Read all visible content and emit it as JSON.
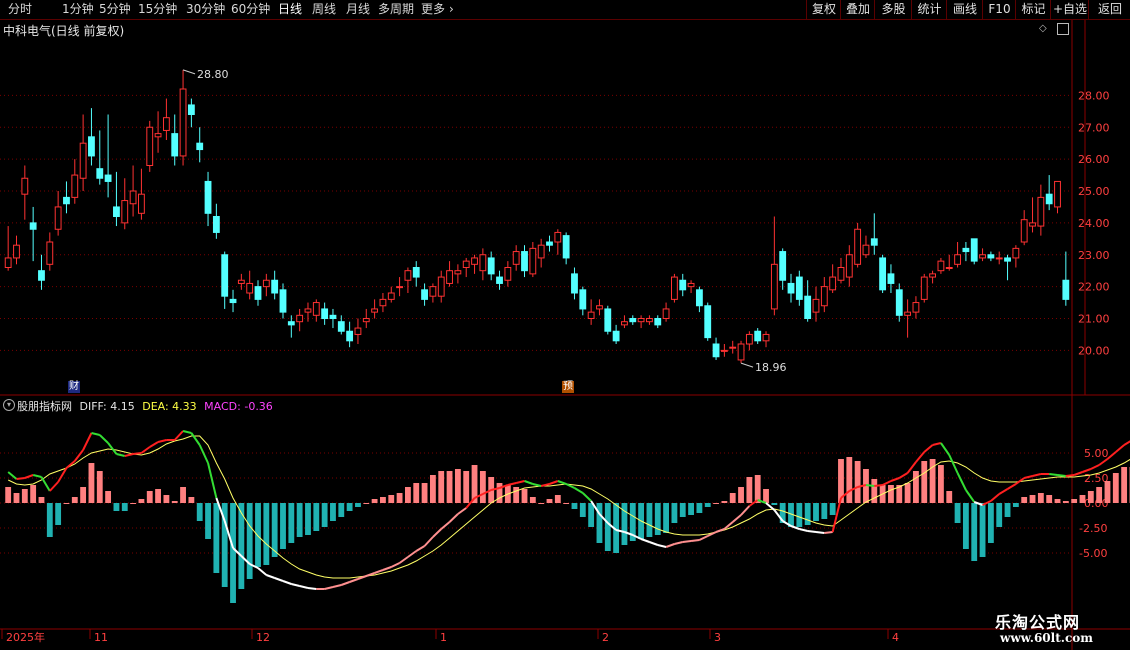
{
  "toolbar": {
    "periods": [
      "分时",
      "1分钟",
      "5分钟",
      "15分钟",
      "30分钟",
      "60分钟",
      "日线",
      "周线",
      "月线",
      "多周期",
      "更多"
    ],
    "active_period": "日线",
    "more_chevron": "›",
    "right_buttons": [
      "复权",
      "叠加",
      "多股",
      "统计",
      "画线",
      "F10",
      "标记",
      "+自选",
      "返回"
    ]
  },
  "stock": {
    "title": "中科电气(日线 前复权)",
    "high_label": "28.80",
    "low_label": "18.96"
  },
  "price_axis": [
    "28.00",
    "27.00",
    "26.00",
    "25.00",
    "24.00",
    "23.00",
    "22.00",
    "21.00",
    "20.00"
  ],
  "event_badges": {
    "cai": "财",
    "yu": "预"
  },
  "indicator": {
    "name": "股朋指标网",
    "diff": "DIFF: 4.15",
    "dea": "DEA: 4.33",
    "macd": "MACD: -0.36"
  },
  "macd_axis": [
    "5.00",
    "2.50",
    "0.00",
    "-2.50",
    "-5.00"
  ],
  "date_axis": [
    "2025年",
    "11",
    "12",
    "1",
    "2",
    "3",
    "4"
  ],
  "watermark": {
    "line1": "乐淘公式网",
    "line2": "www.60lt.com"
  },
  "colors": {
    "up": "#ff3232",
    "up_fill": "#000000",
    "down": "#54ffff",
    "grid": "#7a0000",
    "hist_pos": "#ff8080",
    "hist_neg": "#20b2b2",
    "diff": "#ff2020",
    "dea": "#ffff66",
    "axis_text": "#ff4040"
  },
  "chart_data": {
    "type": "candlestick",
    "price_ylim": [
      18.6,
      29.8
    ],
    "candles": [
      [
        22.6,
        22.9,
        23.9,
        22.5
      ],
      [
        22.9,
        23.3,
        23.6,
        22.7
      ],
      [
        24.9,
        25.4,
        25.8,
        24.1
      ],
      [
        24.0,
        23.8,
        24.5,
        22.8
      ],
      [
        22.5,
        22.2,
        23.0,
        21.9
      ],
      [
        22.7,
        23.4,
        23.7,
        22.5
      ],
      [
        23.8,
        24.5,
        25.0,
        23.6
      ],
      [
        24.8,
        24.6,
        25.3,
        24.3
      ],
      [
        24.8,
        25.5,
        26.0,
        24.6
      ],
      [
        25.4,
        26.5,
        27.4,
        25.0
      ],
      [
        26.7,
        26.1,
        27.6,
        25.8
      ],
      [
        25.7,
        25.4,
        26.9,
        25.2
      ],
      [
        25.5,
        25.3,
        27.4,
        24.8
      ],
      [
        24.5,
        24.2,
        25.6,
        23.9
      ],
      [
        24.0,
        24.7,
        25.4,
        23.8
      ],
      [
        24.6,
        25.0,
        25.8,
        24.2
      ],
      [
        24.3,
        24.9,
        25.7,
        24.1
      ],
      [
        25.8,
        27.0,
        27.2,
        25.6
      ],
      [
        26.7,
        26.8,
        27.5,
        26.2
      ],
      [
        26.9,
        27.3,
        27.9,
        26.6
      ],
      [
        26.8,
        26.1,
        27.4,
        25.8
      ],
      [
        26.1,
        28.2,
        28.8,
        25.8
      ],
      [
        27.7,
        27.4,
        27.9,
        27.0
      ],
      [
        26.5,
        26.3,
        27.0,
        25.9
      ],
      [
        25.3,
        24.3,
        25.6,
        23.9
      ],
      [
        24.2,
        23.7,
        24.6,
        23.5
      ],
      [
        23.0,
        21.7,
        23.1,
        21.3
      ],
      [
        21.6,
        21.5,
        21.9,
        21.2
      ],
      [
        22.1,
        22.2,
        22.4,
        21.9
      ],
      [
        21.8,
        22.1,
        22.5,
        21.6
      ],
      [
        22.0,
        21.6,
        22.2,
        21.4
      ],
      [
        22.0,
        22.2,
        22.4,
        21.7
      ],
      [
        22.2,
        21.8,
        22.5,
        21.6
      ],
      [
        21.9,
        21.2,
        22.1,
        21.0
      ],
      [
        20.9,
        20.8,
        21.1,
        20.4
      ],
      [
        20.9,
        21.1,
        21.3,
        20.6
      ],
      [
        21.2,
        21.3,
        21.5,
        20.9
      ],
      [
        21.1,
        21.5,
        21.6,
        20.9
      ],
      [
        21.3,
        21.0,
        21.5,
        20.8
      ],
      [
        21.1,
        21.0,
        21.3,
        20.7
      ],
      [
        20.9,
        20.6,
        21.1,
        20.5
      ],
      [
        20.6,
        20.3,
        20.9,
        20.1
      ],
      [
        20.5,
        20.7,
        21.0,
        20.2
      ],
      [
        20.9,
        21.0,
        21.3,
        20.7
      ],
      [
        21.2,
        21.3,
        21.6,
        21.0
      ],
      [
        21.4,
        21.6,
        21.8,
        21.2
      ],
      [
        21.6,
        21.8,
        22.0,
        21.5
      ],
      [
        22.0,
        22.0,
        22.3,
        21.7
      ],
      [
        22.2,
        22.5,
        22.6,
        21.8
      ],
      [
        22.6,
        22.3,
        22.8,
        22.0
      ],
      [
        21.9,
        21.6,
        22.1,
        21.4
      ],
      [
        21.7,
        22.0,
        22.1,
        21.5
      ],
      [
        21.7,
        22.3,
        22.5,
        21.5
      ],
      [
        22.1,
        22.5,
        22.8,
        22.0
      ],
      [
        22.4,
        22.5,
        22.7,
        22.1
      ],
      [
        22.6,
        22.8,
        22.9,
        22.3
      ],
      [
        22.7,
        22.9,
        23.0,
        22.4
      ],
      [
        22.5,
        23.0,
        23.2,
        22.2
      ],
      [
        22.9,
        22.4,
        23.1,
        22.2
      ],
      [
        22.3,
        22.1,
        22.5,
        21.9
      ],
      [
        22.2,
        22.6,
        22.8,
        22.0
      ],
      [
        22.7,
        23.1,
        23.3,
        22.5
      ],
      [
        23.1,
        22.5,
        23.3,
        22.3
      ],
      [
        22.4,
        23.2,
        23.4,
        22.3
      ],
      [
        22.9,
        23.3,
        23.5,
        22.6
      ],
      [
        23.4,
        23.3,
        23.6,
        23.1
      ],
      [
        23.4,
        23.7,
        23.8,
        23.0
      ],
      [
        23.6,
        22.9,
        23.7,
        22.7
      ],
      [
        22.4,
        21.8,
        22.6,
        21.6
      ],
      [
        21.9,
        21.3,
        22.0,
        21.1
      ],
      [
        21.0,
        21.2,
        21.6,
        20.8
      ],
      [
        21.3,
        21.4,
        21.6,
        21.1
      ],
      [
        21.3,
        20.6,
        21.4,
        20.5
      ],
      [
        20.6,
        20.3,
        20.8,
        20.2
      ],
      [
        20.8,
        20.9,
        21.1,
        20.7
      ],
      [
        21.0,
        20.9,
        21.1,
        20.8
      ],
      [
        20.9,
        21.0,
        21.1,
        20.7
      ],
      [
        20.9,
        21.0,
        21.1,
        20.8
      ],
      [
        21.0,
        20.8,
        21.1,
        20.7
      ],
      [
        21.0,
        21.3,
        21.5,
        20.9
      ],
      [
        21.6,
        22.3,
        22.4,
        21.5
      ],
      [
        22.2,
        21.9,
        22.4,
        21.7
      ],
      [
        22.0,
        22.1,
        22.2,
        21.8
      ],
      [
        21.9,
        21.4,
        22.0,
        21.2
      ],
      [
        21.4,
        20.4,
        21.5,
        20.3
      ],
      [
        20.2,
        19.8,
        20.4,
        19.7
      ],
      [
        20.0,
        20.0,
        20.2,
        19.8
      ],
      [
        20.1,
        20.1,
        20.3,
        19.9
      ],
      [
        19.7,
        20.2,
        20.3,
        19.6
      ],
      [
        20.2,
        20.5,
        20.6,
        20.0
      ],
      [
        20.6,
        20.3,
        20.7,
        20.2
      ],
      [
        20.3,
        20.5,
        20.6,
        20.1
      ],
      [
        21.3,
        22.7,
        24.2,
        21.1
      ],
      [
        23.1,
        22.2,
        23.2,
        21.9
      ],
      [
        22.1,
        21.8,
        22.4,
        21.5
      ],
      [
        22.3,
        21.6,
        22.5,
        21.4
      ],
      [
        21.7,
        21.0,
        22.2,
        20.9
      ],
      [
        21.2,
        21.6,
        22.0,
        20.9
      ],
      [
        21.4,
        22.0,
        22.3,
        21.2
      ],
      [
        21.9,
        22.3,
        22.7,
        21.8
      ],
      [
        22.2,
        22.6,
        22.9,
        22.1
      ],
      [
        22.3,
        23.0,
        23.3,
        22.0
      ],
      [
        22.7,
        23.8,
        24.0,
        22.6
      ],
      [
        23.0,
        23.3,
        23.6,
        22.9
      ],
      [
        23.5,
        23.3,
        24.3,
        23.0
      ],
      [
        22.9,
        21.9,
        23.0,
        21.8
      ],
      [
        22.4,
        22.1,
        22.7,
        21.8
      ],
      [
        21.9,
        21.1,
        22.1,
        20.9
      ],
      [
        21.1,
        21.2,
        21.6,
        20.4
      ],
      [
        21.2,
        21.5,
        21.7,
        21.0
      ],
      [
        21.6,
        22.3,
        22.4,
        21.5
      ],
      [
        22.3,
        22.4,
        22.5,
        22.1
      ],
      [
        22.5,
        22.8,
        22.9,
        22.4
      ],
      [
        22.6,
        22.6,
        23.0,
        22.5
      ],
      [
        22.7,
        23.0,
        23.4,
        22.6
      ],
      [
        23.2,
        23.1,
        23.4,
        22.8
      ],
      [
        23.5,
        22.8,
        23.5,
        22.7
      ],
      [
        22.9,
        23.0,
        23.2,
        22.8
      ],
      [
        23.0,
        22.9,
        23.1,
        22.8
      ],
      [
        22.9,
        22.9,
        23.1,
        22.7
      ],
      [
        22.9,
        22.8,
        23.0,
        22.2
      ],
      [
        22.9,
        23.2,
        23.3,
        22.6
      ],
      [
        23.4,
        24.1,
        24.4,
        23.3
      ],
      [
        23.9,
        24.0,
        24.8,
        23.7
      ],
      [
        23.9,
        24.8,
        25.2,
        23.6
      ],
      [
        24.9,
        24.6,
        25.5,
        24.4
      ],
      [
        24.5,
        25.3,
        25.3,
        24.3
      ],
      [
        22.2,
        21.6,
        23.1,
        21.4
      ]
    ],
    "diff": [
      3.1,
      2.4,
      2.5,
      2.8,
      2.6,
      1.2,
      2.1,
      3.5,
      4.2,
      5.3,
      7.0,
      6.8,
      6.0,
      4.9,
      4.7,
      4.9,
      5.0,
      5.6,
      6.1,
      6.3,
      6.3,
      7.2,
      7.0,
      5.8,
      4.0,
      0.5,
      -1.8,
      -4.5,
      -5.3,
      -6.1,
      -6.5,
      -7.2,
      -7.5,
      -7.8,
      -8.1,
      -8.3,
      -8.5,
      -8.6,
      -8.6,
      -8.4,
      -8.2,
      -7.9,
      -7.6,
      -7.3,
      -7.0,
      -6.7,
      -6.4,
      -6.0,
      -5.4,
      -4.8,
      -4.3,
      -3.4,
      -2.6,
      -1.9,
      -1.1,
      -0.5,
      0.5,
      0.9,
      1.3,
      1.5,
      1.8,
      2.0,
      2.2,
      1.9,
      1.7,
      1.9,
      2.2,
      1.9,
      1.5,
      1.0,
      0.2,
      -1.1,
      -2.0,
      -2.7,
      -2.9,
      -3.2,
      -3.6,
      -3.9,
      -4.2,
      -4.4,
      -4.1,
      -3.9,
      -3.8,
      -3.7,
      -3.3,
      -2.9,
      -2.6,
      -1.9,
      -1.2,
      -0.3,
      0.3,
      0.0,
      -0.7,
      -1.8,
      -2.3,
      -2.6,
      -2.8,
      -2.9,
      -3.0,
      -2.9,
      0.5,
      1.2,
      1.6,
      1.8,
      1.7,
      1.8,
      2.2,
      2.5,
      3.0,
      4.1,
      5.1,
      5.8,
      6.0,
      4.8,
      3.0,
      1.3,
      0.1,
      -0.2,
      0.2,
      0.9,
      1.4,
      1.9,
      2.5,
      2.7,
      2.9,
      2.9,
      2.8,
      2.7,
      2.8,
      3.1,
      3.4,
      3.8,
      4.4,
      5.1,
      5.8,
      6.3,
      4.2
    ],
    "dea": [
      2.3,
      1.9,
      1.8,
      1.9,
      2.3,
      2.9,
      3.2,
      3.5,
      3.9,
      4.5,
      5.0,
      5.2,
      5.4,
      5.3,
      5.1,
      4.9,
      4.8,
      5.0,
      5.4,
      5.9,
      6.2,
      6.4,
      6.7,
      6.7,
      5.8,
      4.0,
      2.4,
      0.5,
      -1.0,
      -2.3,
      -3.3,
      -4.1,
      -4.8,
      -5.5,
      -6.1,
      -6.6,
      -6.9,
      -7.2,
      -7.4,
      -7.5,
      -7.5,
      -7.5,
      -7.4,
      -7.3,
      -7.2,
      -7.0,
      -6.8,
      -6.5,
      -6.2,
      -5.8,
      -5.3,
      -4.8,
      -4.2,
      -3.5,
      -2.8,
      -2.1,
      -1.4,
      -0.7,
      0.0,
      0.5,
      0.9,
      1.2,
      1.5,
      1.6,
      1.7,
      1.7,
      1.8,
      1.9,
      1.8,
      1.7,
      1.4,
      0.9,
      0.4,
      -0.2,
      -0.8,
      -1.3,
      -1.8,
      -2.2,
      -2.6,
      -2.9,
      -3.1,
      -3.2,
      -3.2,
      -3.2,
      -3.1,
      -2.9,
      -2.7,
      -2.4,
      -2.0,
      -1.6,
      -1.1,
      -0.7,
      -0.6,
      -0.8,
      -1.1,
      -1.4,
      -1.7,
      -2.0,
      -2.2,
      -2.3,
      -1.7,
      -1.1,
      -0.5,
      0.1,
      0.5,
      0.9,
      1.3,
      1.6,
      2.0,
      2.5,
      3.0,
      3.6,
      4.1,
      4.2,
      4.0,
      3.6,
      3.0,
      2.5,
      2.2,
      2.1,
      2.1,
      2.1,
      2.2,
      2.3,
      2.4,
      2.5,
      2.6,
      2.6,
      2.6,
      2.7,
      2.8,
      3.0,
      3.3,
      3.6,
      4.0,
      4.5,
      4.3
    ],
    "macd_ylim": [
      -12.5,
      10.5
    ]
  }
}
